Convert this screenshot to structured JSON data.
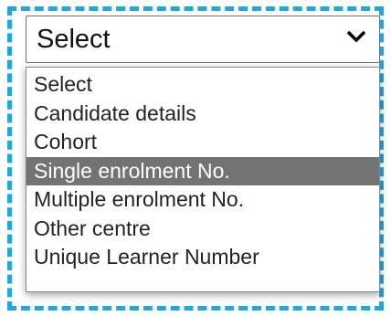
{
  "select": {
    "value": "Select",
    "icon": "chevron-down-icon"
  },
  "dropdown": {
    "options": [
      {
        "label": "Select"
      },
      {
        "label": "Candidate details"
      },
      {
        "label": "Cohort"
      },
      {
        "label": "Single enrolment No.",
        "highlighted": true
      },
      {
        "label": "Multiple enrolment No."
      },
      {
        "label": "Other centre"
      },
      {
        "label": "Unique Learner Number"
      }
    ]
  },
  "colors": {
    "focus_outline": "#1fa8e0",
    "highlight_bg": "#737373",
    "highlight_text": "#ffffff"
  }
}
